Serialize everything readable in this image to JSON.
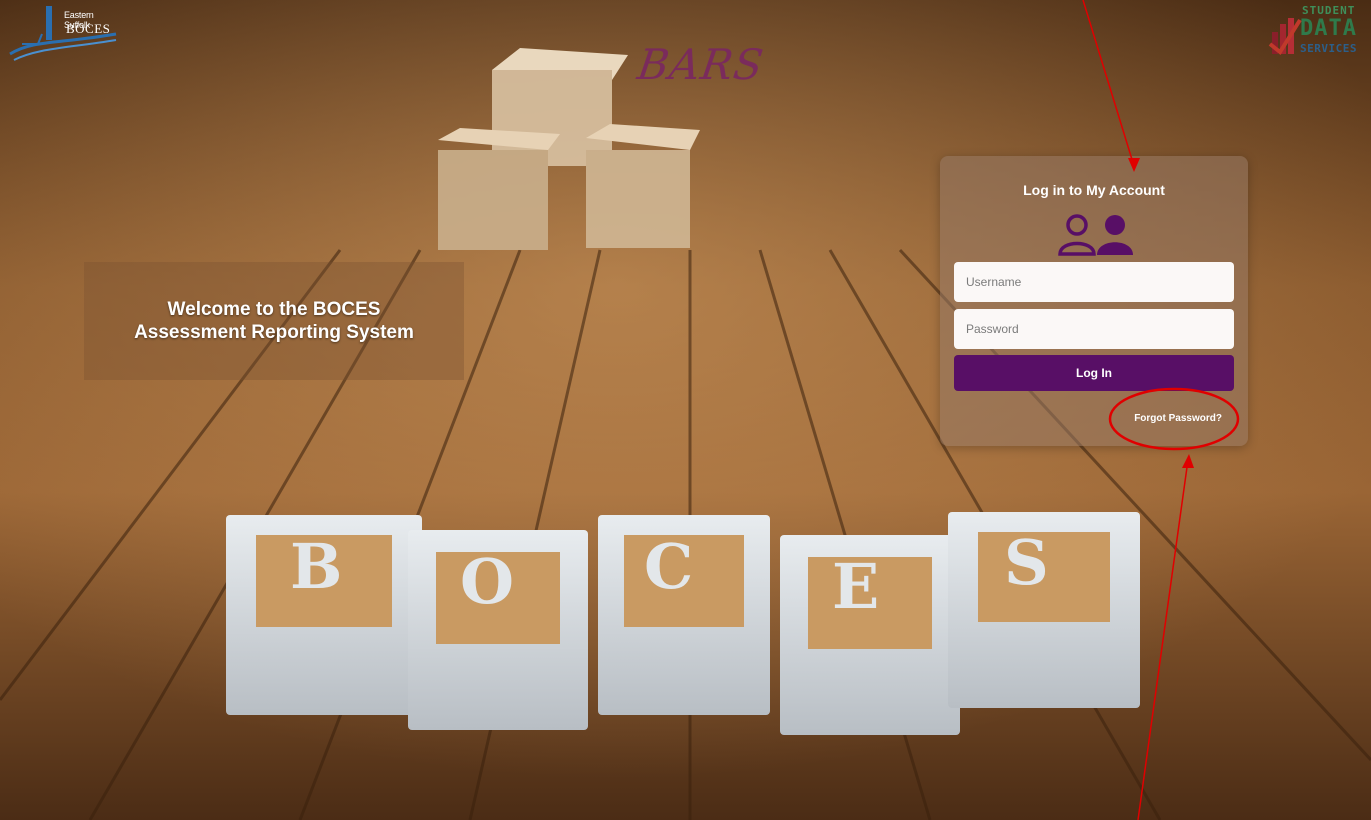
{
  "logos": {
    "left_small": "Eastern Suffolk",
    "left_big": "BOCES",
    "right_line1": "STUDENT",
    "right_line2": "DATA",
    "right_line3": "SERVICES"
  },
  "app_title": "BARS",
  "welcome": {
    "line1": "Welcome to the BOCES",
    "line2": "Assessment Reporting System"
  },
  "login": {
    "title": "Log in to My Account",
    "username_placeholder": "Username",
    "password_placeholder": "Password",
    "submit_label": "Log In",
    "forgot_label": "Forgot Password?"
  },
  "block_letters": [
    "B",
    "O",
    "C",
    "E",
    "S"
  ],
  "colors": {
    "accent": "#580f66",
    "annotation": "#e00000",
    "bars_title": "#7a2b5c"
  },
  "icons": [
    "user-outline-icon",
    "user-filled-icon"
  ]
}
